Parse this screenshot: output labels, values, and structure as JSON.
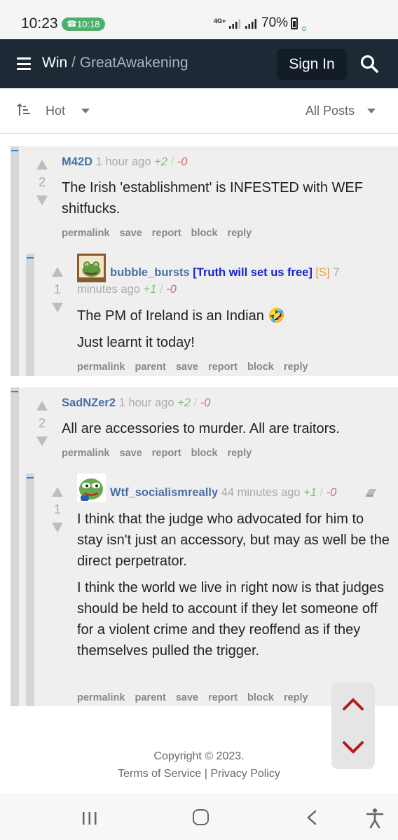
{
  "status_bar": {
    "time": "10:23",
    "call_time": "10:18",
    "network": "4G+",
    "battery": "70%"
  },
  "header": {
    "site": "Win",
    "separator": "/",
    "community": "GreatAwakening",
    "sign_in": "Sign In"
  },
  "sort_bar": {
    "sort": "Hot",
    "filter": "All Posts"
  },
  "comments": [
    {
      "author": "M42D",
      "time": "1 hour ago",
      "up": "+2",
      "slash": "/",
      "down": "-0",
      "score": "2",
      "body": [
        "The Irish 'establishment' is INFESTED with WEF shitfucks."
      ],
      "actions": [
        "permalink",
        "save",
        "report",
        "block",
        "reply"
      ],
      "replies": [
        {
          "author": "bubble_bursts",
          "flair": "[Truth will set us free]",
          "mod_tag": "[S]",
          "time_part1": "7",
          "time_part2": "minutes ago",
          "up": "+1",
          "slash": "/",
          "down": "-0",
          "score": "1",
          "body": [
            "The PM of Ireland is an Indian 🤣",
            "Just learnt it today!"
          ],
          "actions": [
            "permalink",
            "parent",
            "save",
            "report",
            "block",
            "reply"
          ]
        }
      ]
    },
    {
      "author": "SadNZer2",
      "time": "1 hour ago",
      "up": "+2",
      "slash": "/",
      "down": "-0",
      "score": "2",
      "body": [
        "All are accessories to murder. All are traitors."
      ],
      "actions": [
        "permalink",
        "save",
        "report",
        "block",
        "reply"
      ],
      "replies": [
        {
          "author": "Wtf_socialismreally",
          "time": "44 minutes ago",
          "up": "+1",
          "slash": "/",
          "down": "-0",
          "score": "1",
          "body": [
            "I think that the judge who advocated for him to stay isn't just an accessory, but may as well be the direct perpetrator.",
            "I think the world we live in right now is that judges should be held to account if they let someone off for a violent crime and they reoffend as if they themselves pulled the trigger."
          ],
          "actions": [
            "permalink",
            "parent",
            "save",
            "report",
            "block",
            "reply"
          ]
        }
      ]
    }
  ],
  "footer": {
    "copyright": "Copyright © 2023.",
    "terms": "Terms of Service",
    "divider": "|",
    "privacy": "Privacy Policy"
  },
  "colors": {
    "header_bg": "#1d2a36",
    "author": "#4a6fa5",
    "upvotes": "#7bc46f",
    "downvotes": "#d46a6a",
    "chevron": "#b71c1c"
  }
}
